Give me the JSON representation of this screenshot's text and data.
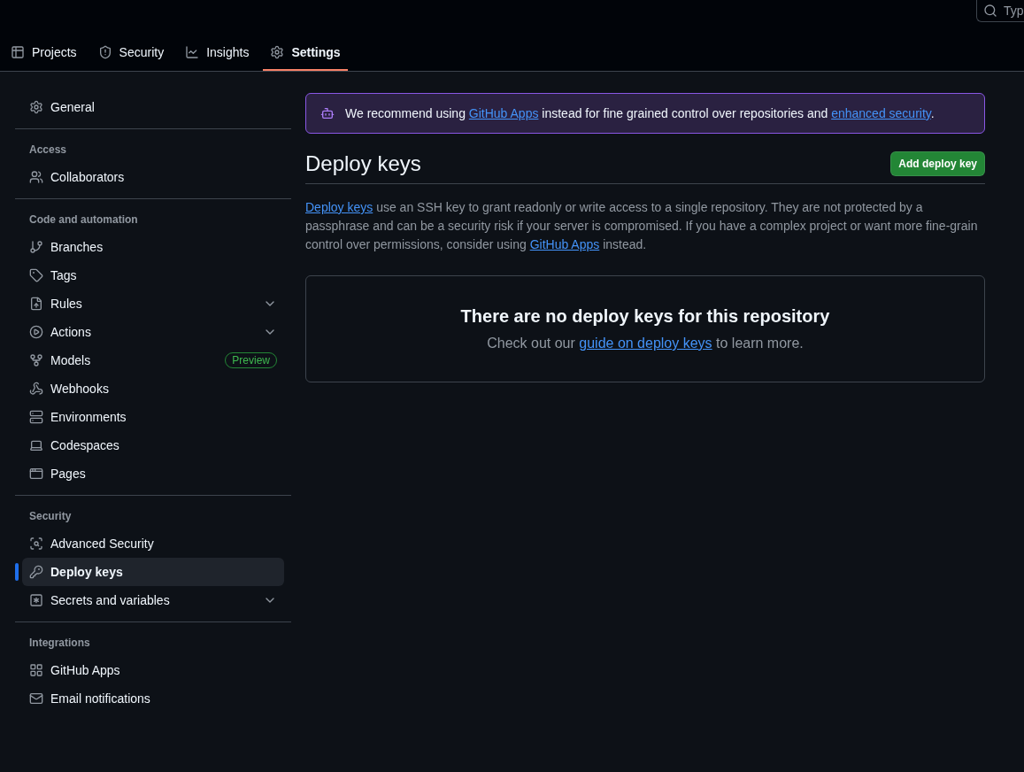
{
  "search": {
    "placeholder": "Typ"
  },
  "tabs": [
    {
      "label": "Projects",
      "selected": false
    },
    {
      "label": "Security",
      "selected": false
    },
    {
      "label": "Insights",
      "selected": false
    },
    {
      "label": "Settings",
      "selected": true
    }
  ],
  "sidebar": {
    "sections": [
      {
        "items": [
          {
            "label": "General",
            "selected": false
          }
        ]
      },
      {
        "heading": "Access",
        "items": [
          {
            "label": "Collaborators",
            "selected": false
          }
        ]
      },
      {
        "heading": "Code and automation",
        "items": [
          {
            "label": "Branches",
            "selected": false
          },
          {
            "label": "Tags",
            "selected": false
          },
          {
            "label": "Rules",
            "selected": false,
            "expandable": true
          },
          {
            "label": "Actions",
            "selected": false,
            "expandable": true
          },
          {
            "label": "Models",
            "selected": false,
            "badge": "Preview"
          },
          {
            "label": "Webhooks",
            "selected": false
          },
          {
            "label": "Environments",
            "selected": false
          },
          {
            "label": "Codespaces",
            "selected": false
          },
          {
            "label": "Pages",
            "selected": false
          }
        ]
      },
      {
        "heading": "Security",
        "items": [
          {
            "label": "Advanced Security",
            "selected": false
          },
          {
            "label": "Deploy keys",
            "selected": true
          },
          {
            "label": "Secrets and variables",
            "selected": false,
            "expandable": true
          }
        ]
      },
      {
        "heading": "Integrations",
        "items": [
          {
            "label": "GitHub Apps",
            "selected": false
          },
          {
            "label": "Email notifications",
            "selected": false
          }
        ]
      }
    ]
  },
  "banner": {
    "segments": [
      {
        "kind": "text",
        "text": "We recommend using "
      },
      {
        "kind": "link",
        "text": "GitHub Apps"
      },
      {
        "kind": "text",
        "text": " instead for fine grained control over repositories and "
      },
      {
        "kind": "link",
        "text": "enhanced security"
      },
      {
        "kind": "text",
        "text": "."
      }
    ]
  },
  "page": {
    "title": "Deploy keys",
    "button": "Add deploy key",
    "description": [
      {
        "kind": "link",
        "text": "Deploy keys"
      },
      {
        "kind": "text",
        "text": " use an SSH key to grant readonly or write access to a single repository. They are not protected by a passphrase and can be a security risk if your server is compromised. If you have a complex project or want more fine-grain control over permissions, consider using "
      },
      {
        "kind": "link",
        "text": "GitHub Apps"
      },
      {
        "kind": "text",
        "text": " instead."
      }
    ]
  },
  "empty_state": {
    "title": "There are no deploy keys for this repository",
    "text": [
      {
        "kind": "text",
        "text": "Check out our "
      },
      {
        "kind": "link",
        "text": "guide on deploy keys"
      },
      {
        "kind": "text",
        "text": " to learn more."
      }
    ]
  }
}
